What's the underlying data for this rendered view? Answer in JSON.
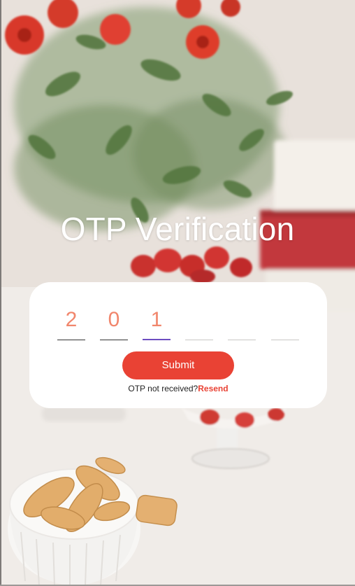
{
  "page": {
    "title": "OTP Verification"
  },
  "otp": {
    "digits": [
      "2",
      "0",
      "1",
      "",
      "",
      ""
    ],
    "active_index": 2
  },
  "actions": {
    "submit_label": "Submit",
    "not_received_text": "OTP not received?",
    "resend_label": "Resend"
  },
  "colors": {
    "accent": "#e94234",
    "digit": "#f1866c",
    "active_underline": "#6d4ec1",
    "card": "#ffffff"
  },
  "background": {
    "icon": "background-photo"
  }
}
